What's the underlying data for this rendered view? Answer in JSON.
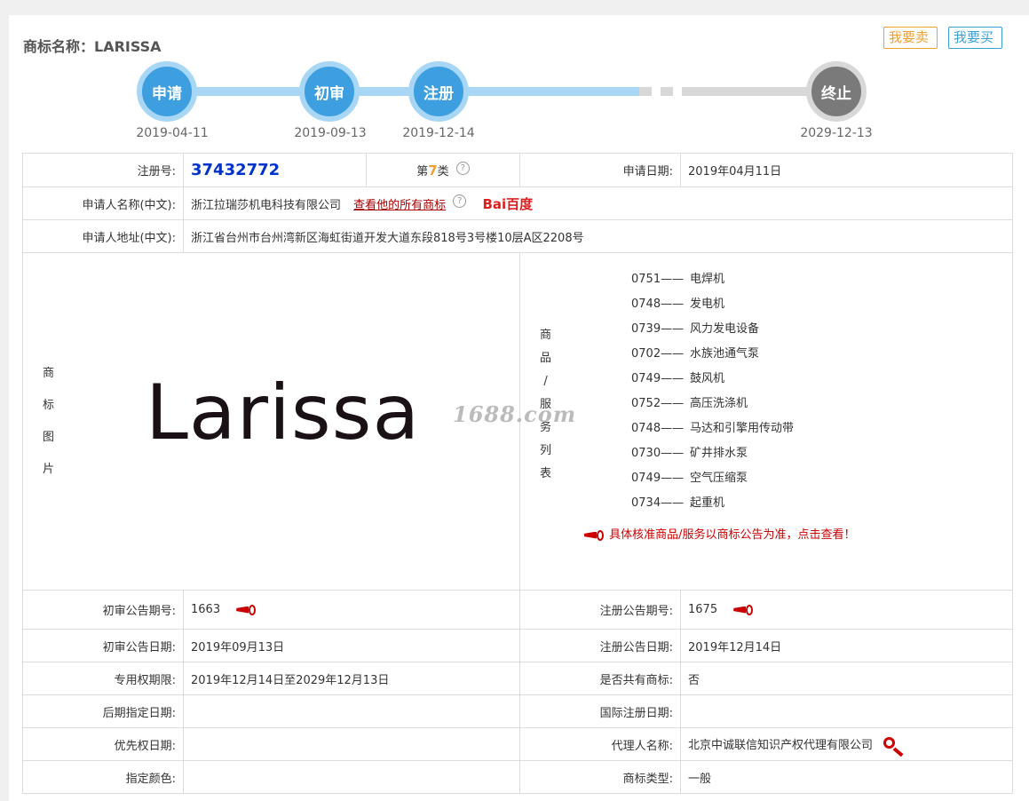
{
  "header": {
    "title": "商标名称：LARISSA",
    "sell_button": "我要卖",
    "buy_button": "我要买"
  },
  "timeline": {
    "steps": [
      {
        "label": "申请",
        "date": "2019-04-11"
      },
      {
        "label": "初审",
        "date": "2019-09-13"
      },
      {
        "label": "注册",
        "date": "2019-12-14"
      },
      {
        "label": "终止",
        "date": "2029-12-13"
      }
    ],
    "colors": {
      "active": "#3d9fe0",
      "active_ring": "#a8d6f5",
      "track_done": "#a8d6f5",
      "track_future": "#d8d8d8",
      "end": "#7a7a7a"
    }
  },
  "info": {
    "reg_no_label": "注册号:",
    "reg_no": "37432772",
    "class_prefix": "第",
    "class_num": "7",
    "class_suffix": "类",
    "apply_date_label": "申请日期:",
    "apply_date": "2019年04月11日",
    "applicant_label": "申请人名称(中文):",
    "applicant": "浙江拉瑞莎机电科技有限公司",
    "view_all_link": "查看他的所有商标",
    "baidu": "Bai百度",
    "address_label": "申请人地址(中文):",
    "address": "浙江省台州市台州湾新区海虹街道开发大道东段818号3号楼10层A区2208号",
    "image_label_chars": [
      "商",
      "标",
      "图",
      "片"
    ],
    "mark_text": "Larissa",
    "watermark": "1688.com",
    "goods_label_chars": [
      "商",
      "品",
      "/",
      "服",
      "务",
      "列",
      "表"
    ],
    "goods": [
      {
        "code": "0751——",
        "name": "电焊机"
      },
      {
        "code": "0748——",
        "name": "发电机"
      },
      {
        "code": "0739——",
        "name": "风力发电设备"
      },
      {
        "code": "0702——",
        "name": "水族池通气泵"
      },
      {
        "code": "0749——",
        "name": "鼓风机"
      },
      {
        "code": "0752——",
        "name": "高压洗涤机"
      },
      {
        "code": "0748——",
        "name": "马达和引擎用传动带"
      },
      {
        "code": "0730——",
        "name": "矿井排水泵"
      },
      {
        "code": "0749——",
        "name": "空气压缩泵"
      },
      {
        "code": "0734——",
        "name": "起重机"
      }
    ],
    "goods_note": "具体核准商品/服务以商标公告为准，点击查看！",
    "prelim_no_label": "初审公告期号:",
    "prelim_no": "1663",
    "reg_pub_no_label": "注册公告期号:",
    "reg_pub_no": "1675",
    "prelim_date_label": "初审公告日期:",
    "prelim_date": "2019年09月13日",
    "reg_pub_date_label": "注册公告日期:",
    "reg_pub_date": "2019年12月14日",
    "exclusive_label": "专用权期限:",
    "exclusive": "2019年12月14日至2029年12月13日",
    "shared_label": "是否共有商标:",
    "shared": "否",
    "later_date_label": "后期指定日期:",
    "later_date": "",
    "intl_date_label": "国际注册日期:",
    "intl_date": "",
    "priority_label": "优先权日期:",
    "priority": "",
    "agent_label": "代理人名称:",
    "agent": "北京中诚联信知识产权代理有限公司",
    "color_label": "指定颜色:",
    "color": "",
    "type_label": "商标类型:",
    "type": "一般"
  }
}
